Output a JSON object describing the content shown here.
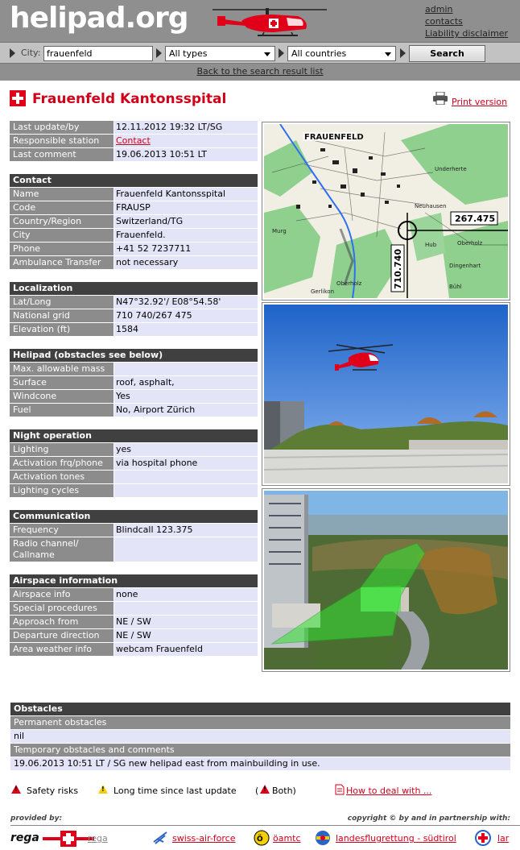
{
  "header": {
    "logo": "helipad.org",
    "links": [
      "admin",
      "contacts",
      "Liability disclaimer"
    ]
  },
  "search": {
    "city_label": "City:",
    "city_value": "frauenfeld",
    "type_selected": "All types",
    "country_selected": "All countries",
    "button": "Search"
  },
  "back_link": "Back to the search result list",
  "page": {
    "title": "Frauenfeld Kantonsspital",
    "print": "Print version"
  },
  "sections": [
    {
      "heading": "",
      "rows": [
        {
          "label": "Last update/by",
          "value": "12.11.2012 19:32 LT/SG"
        },
        {
          "label": "Responsible station",
          "value": "Contact",
          "link": true
        },
        {
          "label": "Last comment",
          "value": "19.06.2013 10:51 LT"
        }
      ]
    },
    {
      "heading": "Contact",
      "rows": [
        {
          "label": "Name",
          "value": "Frauenfeld Kantonsspital"
        },
        {
          "label": "Code",
          "value": "FRAUSP"
        },
        {
          "label": "Country/Region",
          "value": "Switzerland/TG"
        },
        {
          "label": "City",
          "value": "Frauenfeld."
        },
        {
          "label": "Phone",
          "value": "+41 52 7237711"
        },
        {
          "label": "Ambulance Transfer",
          "value": "not necessary"
        }
      ]
    },
    {
      "heading": "Localization",
      "rows": [
        {
          "label": "Lat/Long",
          "value": "N47°32.92'/ E08°54.58'"
        },
        {
          "label": "National grid",
          "value": "710 740/267 475"
        },
        {
          "label": "Elevation (ft)",
          "value": "1584"
        }
      ]
    },
    {
      "heading": "Helipad (obstacles see below)",
      "rows": [
        {
          "label": "Max. allowable mass",
          "value": ""
        },
        {
          "label": "Surface",
          "value": "roof, asphalt,"
        },
        {
          "label": "Windcone",
          "value": "Yes"
        },
        {
          "label": "Fuel",
          "value": "No, Airport Zürich"
        }
      ]
    },
    {
      "heading": "Night operation",
      "rows": [
        {
          "label": "Lighting",
          "value": "yes"
        },
        {
          "label": "Activation frq/phone",
          "value": "via hospital phone"
        },
        {
          "label": "Activation tones",
          "value": ""
        },
        {
          "label": "Lighting cycles",
          "value": ""
        }
      ]
    },
    {
      "heading": "Communication",
      "rows": [
        {
          "label": "Frequency",
          "value": "Blindcall 123.375"
        },
        {
          "label": "Radio channel/ Callname",
          "value": ""
        }
      ]
    },
    {
      "heading": "Airspace information",
      "rows": [
        {
          "label": "Airspace info",
          "value": "none"
        },
        {
          "label": "Special procedures",
          "value": ""
        },
        {
          "label": "Approach from",
          "value": "NE / SW"
        },
        {
          "label": "Departure direction",
          "value": "NE / SW"
        },
        {
          "label": "Area weather info",
          "value": "webcam Frauenfeld"
        }
      ]
    }
  ],
  "map": {
    "town": "FRAUENFELD",
    "grid_east": "267.475",
    "grid_north": "710.740",
    "places": [
      "Murg",
      "Neuhausen",
      "Underherte",
      "Dingenhart",
      "Oberholz",
      "Gerlikon",
      "Hub",
      "Bühl",
      "Oberholz"
    ]
  },
  "obstacles": {
    "heading": "Obstacles",
    "permanent_label": "Permanent obstacles",
    "permanent_value": "nil",
    "temporary_label": "Temporary obstacles and comments",
    "temporary_value": "19.06.2013 10:51 LT / SG  new helipad east from mainbuilding in use."
  },
  "legend": {
    "safety": "Safety risks",
    "longtime": "Long time since last update",
    "both_open": "(",
    "both": "Both)",
    "howto": "How to deal with ..."
  },
  "footer": {
    "provided": "provided by:",
    "copyright": "copyright © by and in partnership with:",
    "rega_logo": "rega",
    "rega_link": "rega",
    "partners": [
      "swiss-air-force",
      "öamtc",
      "landesflugrettung - südtirol",
      "lar"
    ]
  },
  "colors": {
    "accent_red": "#d0001a",
    "header_gray": "#8f8f8f",
    "section_head": "#404040",
    "label_gray": "#8c8c8c",
    "value_bg": "#e4e4f8"
  }
}
